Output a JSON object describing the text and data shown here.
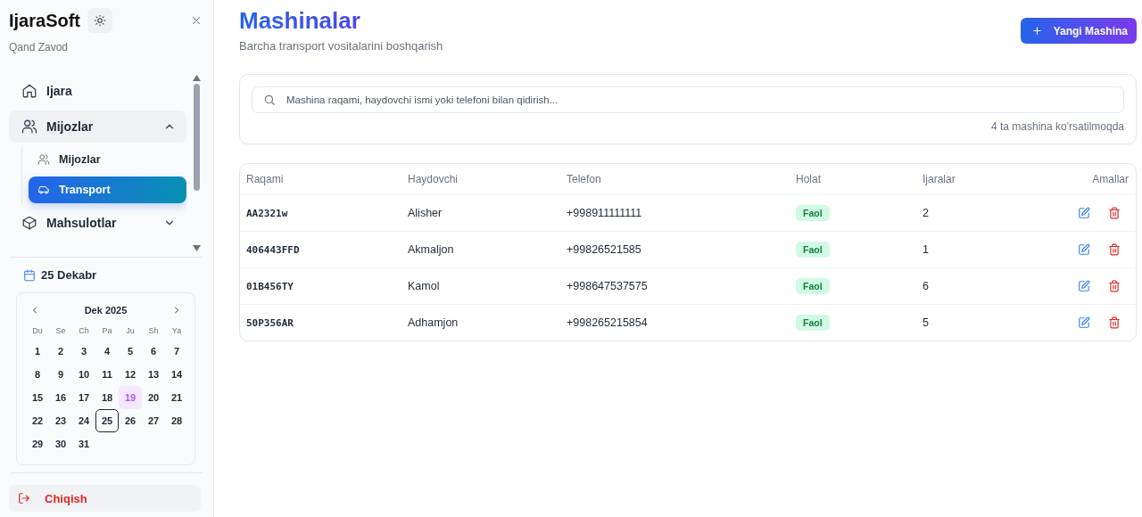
{
  "sidebar": {
    "brand": "IjaraSoft",
    "subtitle": "Qand Zavod",
    "nav": [
      {
        "label": "Ijara"
      },
      {
        "label": "Mijozlar",
        "expanded": true,
        "children": [
          {
            "label": "Mijozlar",
            "selected": false
          },
          {
            "label": "Transport",
            "selected": true
          }
        ]
      },
      {
        "label": "Mahsulotlar",
        "expanded": false
      }
    ],
    "date_label": "25 Dekabr",
    "calendar": {
      "month": "Dek 2025",
      "weekdays": [
        "Du",
        "Se",
        "Ch",
        "Pa",
        "Ju",
        "Sh",
        "Ya"
      ],
      "days": [
        {
          "day": "1",
          "today": false,
          "selected": false
        },
        {
          "day": "2",
          "today": false,
          "selected": false
        },
        {
          "day": "3",
          "today": false,
          "selected": false
        },
        {
          "day": "4",
          "today": false,
          "selected": false
        },
        {
          "day": "5",
          "today": false,
          "selected": false
        },
        {
          "day": "6",
          "today": false,
          "selected": false
        },
        {
          "day": "7",
          "today": false,
          "selected": false
        },
        {
          "day": "8",
          "today": false,
          "selected": false
        },
        {
          "day": "9",
          "today": false,
          "selected": false
        },
        {
          "day": "10",
          "today": false,
          "selected": false
        },
        {
          "day": "11",
          "today": false,
          "selected": false
        },
        {
          "day": "12",
          "today": false,
          "selected": false
        },
        {
          "day": "13",
          "today": false,
          "selected": false
        },
        {
          "day": "14",
          "today": false,
          "selected": false
        },
        {
          "day": "15",
          "today": false,
          "selected": false
        },
        {
          "day": "16",
          "today": false,
          "selected": false
        },
        {
          "day": "17",
          "today": false,
          "selected": false
        },
        {
          "day": "18",
          "today": false,
          "selected": false
        },
        {
          "day": "19",
          "today": false,
          "selected": true
        },
        {
          "day": "20",
          "today": false,
          "selected": false
        },
        {
          "day": "21",
          "today": false,
          "selected": false
        },
        {
          "day": "22",
          "today": false,
          "selected": false
        },
        {
          "day": "23",
          "today": false,
          "selected": false
        },
        {
          "day": "24",
          "today": false,
          "selected": false
        },
        {
          "day": "25",
          "today": true,
          "selected": false
        },
        {
          "day": "26",
          "today": false,
          "selected": false
        },
        {
          "day": "27",
          "today": false,
          "selected": false
        },
        {
          "day": "28",
          "today": false,
          "selected": false
        },
        {
          "day": "29",
          "today": false,
          "selected": false
        },
        {
          "day": "30",
          "today": false,
          "selected": false
        },
        {
          "day": "31",
          "today": false,
          "selected": false
        }
      ]
    },
    "logout": "Chiqish"
  },
  "header": {
    "title": "Mashinalar",
    "subtitle": "Barcha transport vositalarini boshqarish",
    "add_button": "Yangi Mashina"
  },
  "search": {
    "placeholder": "Mashina raqami, haydovchi ismi yoki telefoni bilan qidirish...",
    "result_count": "4 ta mashina ko'rsatilmoqda"
  },
  "table": {
    "columns": [
      "Raqami",
      "Haydovchi",
      "Telefon",
      "Holat",
      "Ijaralar",
      "Amallar"
    ],
    "rows": [
      {
        "plate": "AA2321w",
        "driver": "Alisher",
        "phone": "+998911111111",
        "status": "Faol",
        "rentals": "2"
      },
      {
        "plate": "406443FFD",
        "driver": "Akmaljon",
        "phone": "+99826521585",
        "status": "Faol",
        "rentals": "1"
      },
      {
        "plate": "01B456TY",
        "driver": "Kamol",
        "phone": "+998647537575",
        "status": "Faol",
        "rentals": "6"
      },
      {
        "plate": "50P356AR",
        "driver": "Adhamjon",
        "phone": "+998265215854",
        "status": "Faol",
        "rentals": "5"
      }
    ]
  }
}
